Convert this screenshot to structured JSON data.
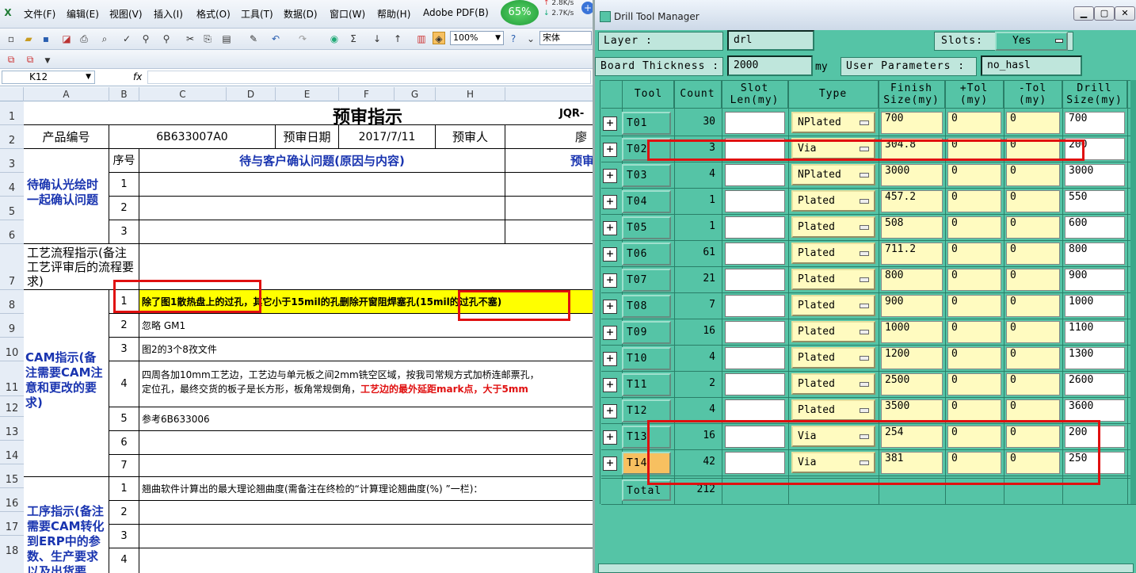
{
  "excel": {
    "menu": [
      "文件(F)",
      "编辑(E)",
      "视图(V)",
      "插入(I)",
      "格式(O)",
      "工具(T)",
      "数据(D)",
      "窗口(W)",
      "帮助(H)",
      "Adobe PDF(B)"
    ],
    "net_percent": "65%",
    "net_up": "2.8K/s",
    "net_down": "2.7K/s",
    "zoom": "100%",
    "font_name": "宋体",
    "name_box": "K12",
    "fx": "fx",
    "columns": [
      "A",
      "B",
      "C",
      "D",
      "E",
      "F",
      "G",
      "H"
    ],
    "rows": [
      "1",
      "2",
      "3",
      "4",
      "5",
      "6",
      "7",
      "8",
      "9",
      "10",
      "11",
      "12",
      "13",
      "14",
      "15",
      "16",
      "17",
      "18"
    ],
    "title": "预审指示",
    "title_right": "JQR-",
    "r2": {
      "label": "产品编号",
      "product": "6B633007A0",
      "date_label": "预审日期",
      "date": "2017/7/11",
      "reviewer_label": "预审人",
      "reviewer": "廖"
    },
    "r3": {
      "seq": "序号",
      "issue_header": "待与客户确认问题(原因与内容)",
      "right": "预审"
    },
    "confirm_section": "待确认光绘时一起确认问题",
    "seq_numbers": [
      "1",
      "2",
      "3"
    ],
    "process_section": "工艺流程指示(备注工艺评审后的流程要求)",
    "cam_section": "CAM指示(备注需要CAM注意和更改的要求)",
    "cam_items": [
      {
        "n": "1",
        "text": "除了图1散热盘上的过孔，其它小于15mil的孔删除开窗阻焊塞孔(15mil的过孔不塞)"
      },
      {
        "n": "2",
        "text": "忽略 GM1"
      },
      {
        "n": "3",
        "text": "图2的3个8孜文件"
      },
      {
        "n": "4",
        "text": "四周各加10mm工艺边，工艺边与单元板之间2mm铣空区域，按我司常规方式加桥连邮票孔，",
        "text2": "定位孔，最终交货的板子是长方形，板角常规倒角，",
        "text2_red": "工艺边的最外延距mark点，大于5mm"
      },
      {
        "n": "5",
        "text": "参考6B633006"
      },
      {
        "n": "6",
        "text": ""
      },
      {
        "n": "7",
        "text": ""
      }
    ],
    "proc_section": "工序指示(备注需要CAM转化到ERP中的参数、生产要求以及出货要",
    "proc_items": [
      {
        "n": "1",
        "text": "翘曲软件计算出的最大理论翘曲度(需备注在终检的“计算理论翘曲度(%) ”一栏)："
      },
      {
        "n": "2",
        "text": ""
      },
      {
        "n": "3",
        "text": ""
      },
      {
        "n": "4",
        "text": ""
      }
    ]
  },
  "dtm": {
    "title": "Drill Tool Manager",
    "layer_label": "Layer          :",
    "layer_value": "drl",
    "slots_label": "Slots:",
    "slots_value": "Yes",
    "thickness_label": "Board Thickness :",
    "thickness_value": "2000",
    "thickness_unit": "my",
    "user_params_label": "User Parameters :",
    "user_params_value": "no_hasl",
    "headers": {
      "tool": "Tool",
      "count": "Count",
      "slot1": "Slot",
      "slot2": "Len(my)",
      "type": "Type",
      "finish1": "Finish",
      "finish2": "Size(my)",
      "ptol1": "+Tol",
      "ptol2": "(my)",
      "ntol1": "-Tol",
      "ntol2": "(my)",
      "drill1": "Drill",
      "drill2": "Size(my)"
    },
    "tools": [
      {
        "tool": "T01",
        "count": "30",
        "type": "NPlated",
        "finish": "700",
        "ptol": "0",
        "ntol": "0",
        "drill": "700"
      },
      {
        "tool": "T02",
        "count": "3",
        "type": "Via",
        "finish": "304.8",
        "ptol": "0",
        "ntol": "0",
        "drill": "200"
      },
      {
        "tool": "T03",
        "count": "4",
        "type": "NPlated",
        "finish": "3000",
        "ptol": "0",
        "ntol": "0",
        "drill": "3000"
      },
      {
        "tool": "T04",
        "count": "1",
        "type": "Plated",
        "finish": "457.2",
        "ptol": "0",
        "ntol": "0",
        "drill": "550"
      },
      {
        "tool": "T05",
        "count": "1",
        "type": "Plated",
        "finish": "508",
        "ptol": "0",
        "ntol": "0",
        "drill": "600"
      },
      {
        "tool": "T06",
        "count": "61",
        "type": "Plated",
        "finish": "711.2",
        "ptol": "0",
        "ntol": "0",
        "drill": "800"
      },
      {
        "tool": "T07",
        "count": "21",
        "type": "Plated",
        "finish": "800",
        "ptol": "0",
        "ntol": "0",
        "drill": "900"
      },
      {
        "tool": "T08",
        "count": "7",
        "type": "Plated",
        "finish": "900",
        "ptol": "0",
        "ntol": "0",
        "drill": "1000"
      },
      {
        "tool": "T09",
        "count": "16",
        "type": "Plated",
        "finish": "1000",
        "ptol": "0",
        "ntol": "0",
        "drill": "1100"
      },
      {
        "tool": "T10",
        "count": "4",
        "type": "Plated",
        "finish": "1200",
        "ptol": "0",
        "ntol": "0",
        "drill": "1300"
      },
      {
        "tool": "T11",
        "count": "2",
        "type": "Plated",
        "finish": "2500",
        "ptol": "0",
        "ntol": "0",
        "drill": "2600"
      },
      {
        "tool": "T12",
        "count": "4",
        "type": "Plated",
        "finish": "3500",
        "ptol": "0",
        "ntol": "0",
        "drill": "3600"
      },
      {
        "tool": "T13",
        "count": "16",
        "type": "Via",
        "finish": "254",
        "ptol": "0",
        "ntol": "0",
        "drill": "200"
      },
      {
        "tool": "T14",
        "count": "42",
        "type": "Via",
        "finish": "381",
        "ptol": "0",
        "ntol": "0",
        "drill": "250"
      }
    ],
    "total_label": "Total",
    "total_value": "212"
  },
  "colors": {
    "accent_teal": "#55c4a6",
    "highlight_yellow": "#ffff00",
    "annotation_red": "#e01010",
    "label_blue": "#1a35b0",
    "selected_tool": "#f7c060"
  }
}
